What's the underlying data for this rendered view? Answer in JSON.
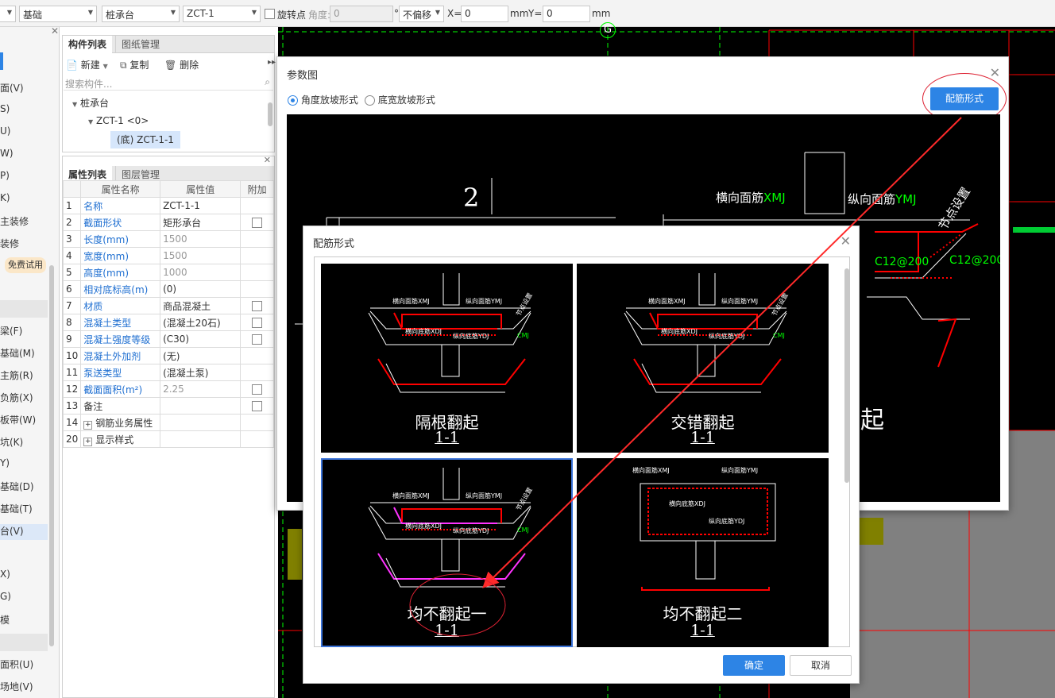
{
  "toolbar": {
    "floor_select": "基础",
    "category_select": "桩承台",
    "component_select": "ZCT-1",
    "rotate_label": "旋转点",
    "angle_label": "角度:",
    "angle_value": "0",
    "angle_unit": "°",
    "offset_select": "不偏移",
    "x_label": "X=",
    "x_value": "0",
    "x_unit": "mm",
    "y_label": "Y=",
    "y_value": "0",
    "y_unit": "mm"
  },
  "left_nav": {
    "items": [
      "面(V)",
      "S)",
      "U)",
      "W)",
      "P)",
      "K)",
      "主装修",
      "装修",
      "免费试用",
      "梁(F)",
      "基础(M)",
      "主筋(R)",
      "负筋(X)",
      "板带(W)",
      "坑(K)",
      "Y)",
      "基础(D)",
      "基础(T)",
      "台(V)",
      "X)",
      "G)",
      "模",
      "面积(U)",
      "场地(V)"
    ]
  },
  "component_list": {
    "tab_active": "构件列表",
    "tab_inactive": "图纸管理",
    "new_label": "新建",
    "copy_label": "复制",
    "delete_label": "删除",
    "search_placeholder": "搜索构件...",
    "tree_root": "桩承台",
    "tree_child": "ZCT-1 <0>",
    "tree_leaf": "(底) ZCT-1-1"
  },
  "properties": {
    "tab_active": "属性列表",
    "tab_inactive": "图层管理",
    "headers": [
      "属性名称",
      "属性值",
      "附加"
    ],
    "rows": [
      {
        "num": "1",
        "name": "名称",
        "value": "ZCT-1-1",
        "blue": true,
        "gray": false,
        "check": false
      },
      {
        "num": "2",
        "name": "截面形状",
        "value": "矩形承台",
        "blue": true,
        "gray": false,
        "check": true
      },
      {
        "num": "3",
        "name": "长度(mm)",
        "value": "1500",
        "blue": true,
        "gray": true,
        "check": false
      },
      {
        "num": "4",
        "name": "宽度(mm)",
        "value": "1500",
        "blue": true,
        "gray": true,
        "check": false
      },
      {
        "num": "5",
        "name": "高度(mm)",
        "value": "1000",
        "blue": true,
        "gray": true,
        "check": false
      },
      {
        "num": "6",
        "name": "相对底标高(m)",
        "value": "(0)",
        "blue": true,
        "gray": false,
        "check": false
      },
      {
        "num": "7",
        "name": "材质",
        "value": "商品混凝土",
        "blue": true,
        "gray": false,
        "check": true
      },
      {
        "num": "8",
        "name": "混凝土类型",
        "value": "(混凝土20石)",
        "blue": true,
        "gray": false,
        "check": true
      },
      {
        "num": "9",
        "name": "混凝土强度等级",
        "value": "(C30)",
        "blue": true,
        "gray": false,
        "check": true
      },
      {
        "num": "10",
        "name": "混凝土外加剂",
        "value": "(无)",
        "blue": true,
        "gray": false,
        "check": false
      },
      {
        "num": "11",
        "name": "泵送类型",
        "value": "(混凝土泵)",
        "blue": true,
        "gray": false,
        "check": false
      },
      {
        "num": "12",
        "name": "截面面积(m²)",
        "value": "2.25",
        "blue": true,
        "gray": true,
        "check": true
      },
      {
        "num": "13",
        "name": "备注",
        "value": "",
        "blue": false,
        "gray": false,
        "check": true
      },
      {
        "num": "14",
        "name": "钢筋业务属性",
        "value": "",
        "blue": false,
        "gray": false,
        "check": false,
        "expand": true
      },
      {
        "num": "20",
        "name": "显示样式",
        "value": "",
        "blue": false,
        "gray": false,
        "check": false,
        "expand": true
      }
    ]
  },
  "canvas": {
    "axis_label": "G"
  },
  "param_dialog": {
    "title": "参数图",
    "radio_1": "角度放坡形式",
    "radio_2": "底宽放坡形式",
    "rebar_button": "配筋形式",
    "drawing_number": "2",
    "top_label": "横向面筋",
    "top_label_code": "XMJ",
    "long_label": "纵向面筋",
    "long_label_code": "YMJ",
    "node_label": "节点设置",
    "c12_a": "C12@200",
    "c12_b": "C12@200",
    "partial_text": "起"
  },
  "rebar_dialog": {
    "title": "配筋形式",
    "options": [
      {
        "label": "隔根翻起",
        "sub": "1-1"
      },
      {
        "label": "交错翻起",
        "sub": "1-1"
      },
      {
        "label": "均不翻起一",
        "sub": "1-1"
      },
      {
        "label": "均不翻起二",
        "sub": "1-1"
      }
    ],
    "mini_labels": {
      "xmj": "横向面筋XMJ",
      "ymj": "纵向面筋YMJ",
      "xdj": "横向底筋XDJ",
      "ydj": "纵向底筋YDJ",
      "cmj": "CMJ",
      "node": "节点设置"
    },
    "ok_label": "确定",
    "cancel_label": "取消"
  }
}
